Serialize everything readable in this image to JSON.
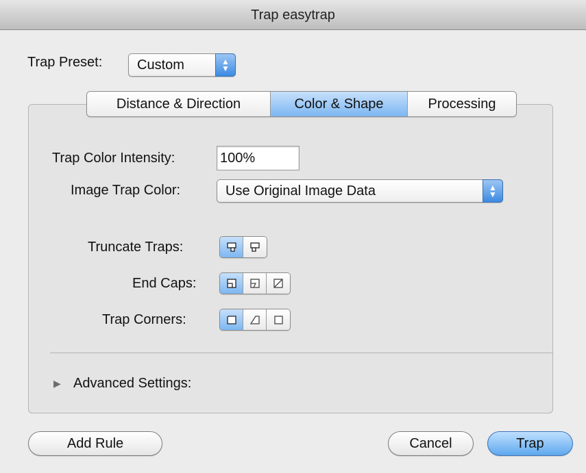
{
  "window": {
    "title": "Trap easytrap"
  },
  "preset": {
    "label": "Trap Preset:",
    "value": "Custom"
  },
  "tabs": [
    {
      "label": "Distance & Direction",
      "active": false
    },
    {
      "label": "Color & Shape",
      "active": true
    },
    {
      "label": "Processing",
      "active": false
    }
  ],
  "form": {
    "intensity_label": "Trap Color Intensity:",
    "intensity_value": "100%",
    "image_color_label": "Image Trap Color:",
    "image_color_value": "Use Original Image Data",
    "truncate_label": "Truncate Traps:",
    "endcaps_label": "End Caps:",
    "corners_label": "Trap Corners:"
  },
  "truncate_options": [
    {
      "icon": "truncate-neutral-icon",
      "selected": true
    },
    {
      "icon": "truncate-edge-icon",
      "selected": false
    }
  ],
  "endcap_options": [
    {
      "icon": "endcap-miter-icon",
      "selected": true
    },
    {
      "icon": "endcap-overlap-icon",
      "selected": false
    },
    {
      "icon": "endcap-diagonal-icon",
      "selected": false
    }
  ],
  "corner_options": [
    {
      "icon": "corner-miter-icon",
      "selected": true
    },
    {
      "icon": "corner-round-icon",
      "selected": false
    },
    {
      "icon": "corner-bevel-icon",
      "selected": false
    }
  ],
  "advanced": {
    "label": "Advanced Settings:",
    "expanded": false
  },
  "buttons": {
    "add_rule": "Add Rule",
    "cancel": "Cancel",
    "trap": "Trap"
  },
  "colors": {
    "accent": "#6aaeef",
    "window_bg": "#ececec"
  }
}
